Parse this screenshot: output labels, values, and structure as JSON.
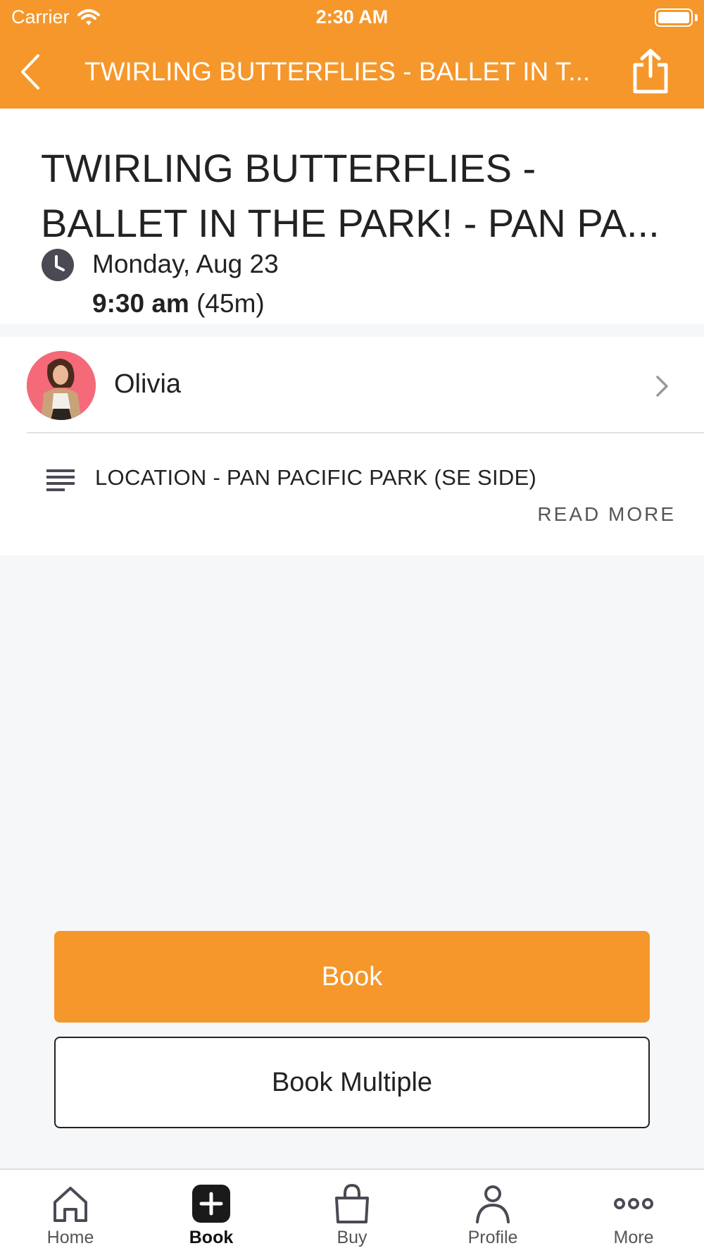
{
  "status_bar": {
    "carrier": "Carrier",
    "time": "2:30 AM"
  },
  "nav": {
    "title": "TWIRLING BUTTERFLIES - BALLET IN T...",
    "back_icon": "chevron-left-icon",
    "share_icon": "share-icon"
  },
  "event": {
    "title": "TWIRLING BUTTERFLIES - BALLET IN THE PARK! - PAN PA...",
    "date": "Monday, Aug 23",
    "time": "9:30 am",
    "duration": "(45m)"
  },
  "instructor": {
    "name": "Olivia"
  },
  "description": {
    "text": "LOCATION - PAN PACIFIC PARK (SE SIDE)",
    "read_more": "READ MORE"
  },
  "actions": {
    "book": "Book",
    "book_multiple": "Book Multiple"
  },
  "tabs": [
    {
      "label": "Home",
      "icon": "home-icon"
    },
    {
      "label": "Book",
      "icon": "plus-square-icon",
      "active": true
    },
    {
      "label": "Buy",
      "icon": "shopping-bag-icon"
    },
    {
      "label": "Profile",
      "icon": "person-icon"
    },
    {
      "label": "More",
      "icon": "more-dots-icon"
    }
  ],
  "colors": {
    "accent": "#f5972a",
    "background": "#f6f7f9",
    "avatar_bg": "#f46a79"
  }
}
